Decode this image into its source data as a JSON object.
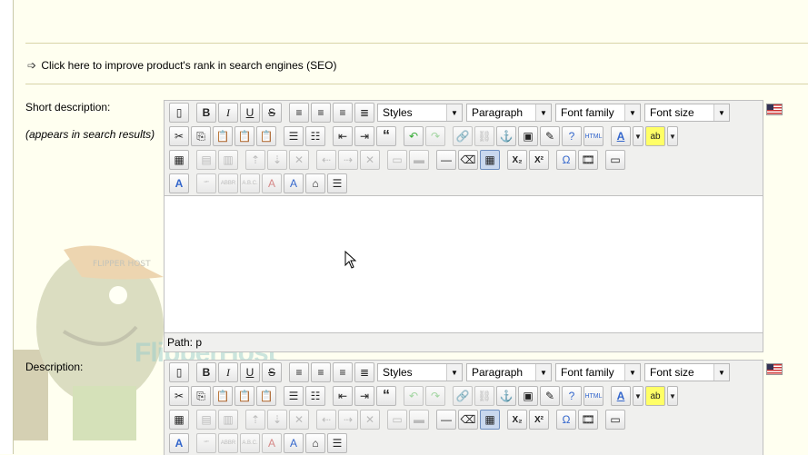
{
  "seo_link": "Click here to improve product's rank in search engines (SEO)",
  "short_description": {
    "label": "Short description:",
    "sub_label": "(appears in search results)",
    "path": "Path: p"
  },
  "description": {
    "label": "Description:"
  },
  "brand": "FlipperHost",
  "mascot_cap_text": "FLIPPER HOST",
  "toolbar": {
    "bold": "B",
    "italic": "I",
    "underline": "U",
    "strike": "S",
    "styles": "Styles",
    "format": "Paragraph",
    "font_family": "Font family",
    "font_size": "Font size",
    "blockquote": "“",
    "omega": "Ω",
    "sub": "X₂",
    "sup": "X²",
    "abbr": "ABBR",
    "acronym": "A.B.C.",
    "cite": "“”",
    "html": "HTML",
    "font_color": "A",
    "bg_color": "ab"
  }
}
